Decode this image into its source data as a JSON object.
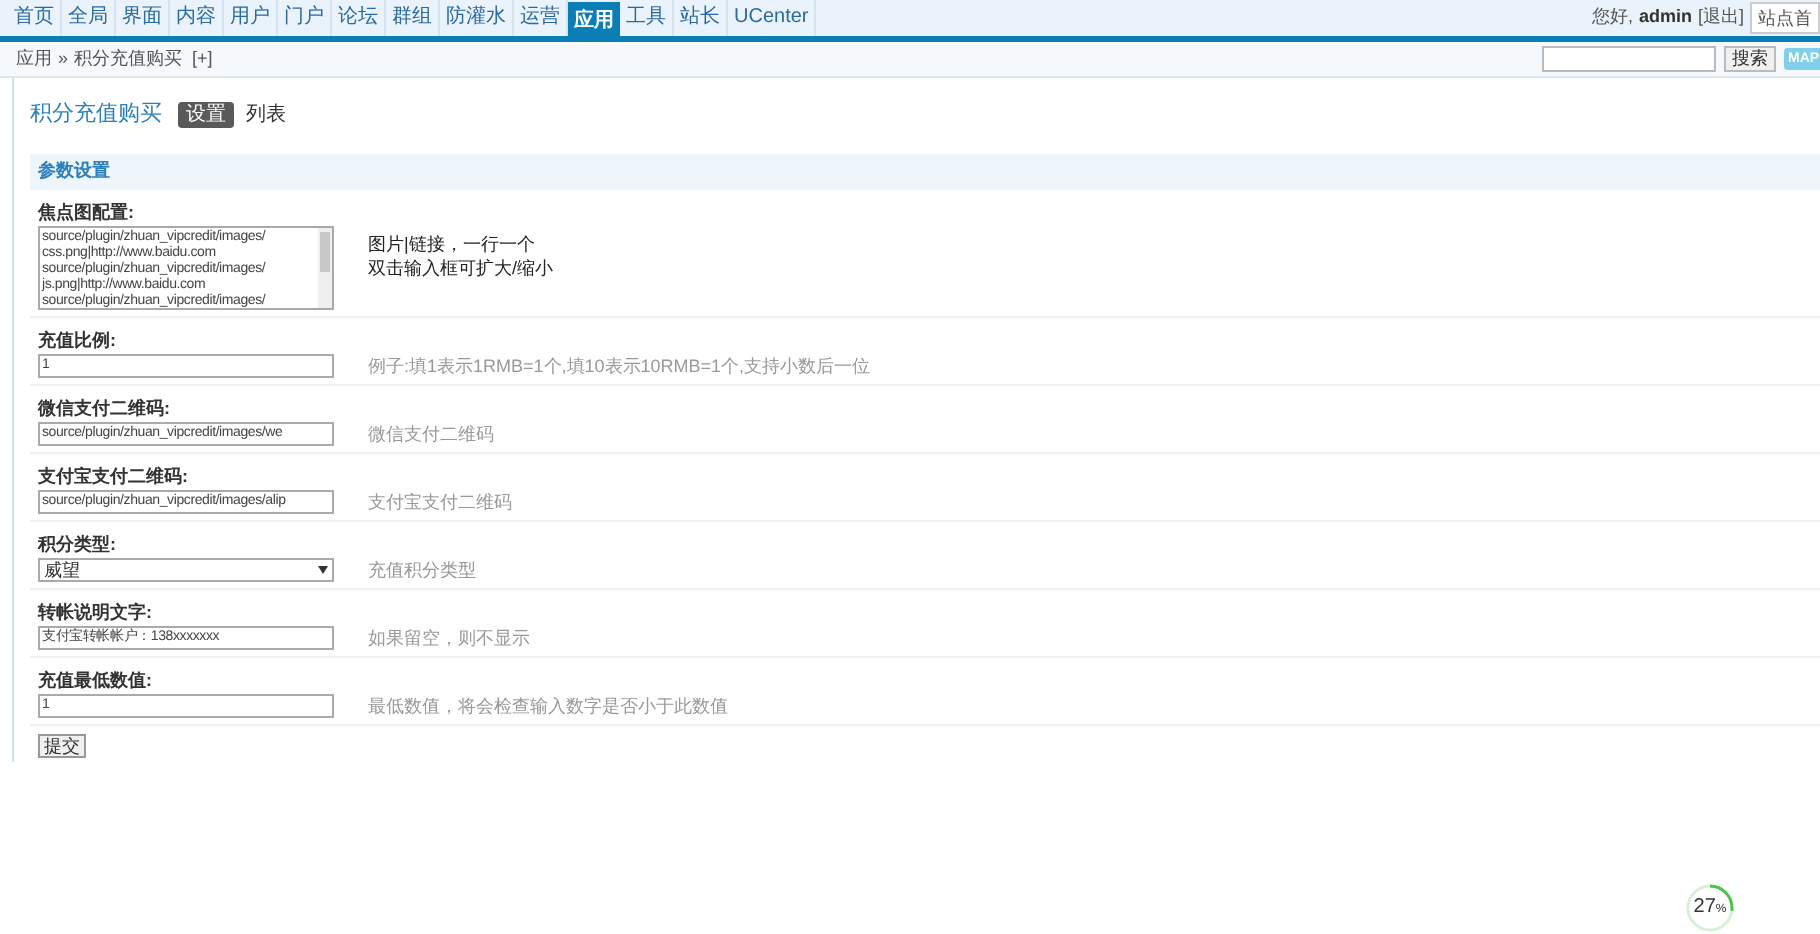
{
  "top_nav": {
    "tabs": [
      {
        "label": "首页",
        "selected": false
      },
      {
        "label": "全局",
        "selected": false
      },
      {
        "label": "界面",
        "selected": false
      },
      {
        "label": "内容",
        "selected": false
      },
      {
        "label": "用户",
        "selected": false
      },
      {
        "label": "门户",
        "selected": false
      },
      {
        "label": "论坛",
        "selected": false
      },
      {
        "label": "群组",
        "selected": false
      },
      {
        "label": "防灌水",
        "selected": false
      },
      {
        "label": "运营",
        "selected": false
      },
      {
        "label": "应用",
        "selected": true
      },
      {
        "label": "工具",
        "selected": false
      },
      {
        "label": "站长",
        "selected": false
      },
      {
        "label": "UCenter",
        "selected": false
      }
    ],
    "greeting": "您好,",
    "user": "admin",
    "logout": "[退出]",
    "site_home": "站点首"
  },
  "breadcrumb": {
    "items": [
      "应用",
      "积分充值购买"
    ],
    "separator": "»",
    "add": "[+]"
  },
  "search": {
    "button": "搜索",
    "map": "MAP"
  },
  "page": {
    "title": "积分充值购买",
    "subtabs": [
      {
        "label": "设置",
        "selected": true
      },
      {
        "label": "列表",
        "selected": false
      }
    ]
  },
  "section": {
    "title": "参数设置"
  },
  "fields": [
    {
      "kind": "textarea",
      "label": "焦点图配置:",
      "lines": [
        "source/plugin/zhuan_vipcredit/images/",
        "css.png|http://www.baidu.com",
        "source/plugin/zhuan_vipcredit/images/",
        "js.png|http://www.baidu.com",
        "source/plugin/zhuan_vipcredit/images/"
      ],
      "hint": [
        "图片|链接，一行一个",
        "双击输入框可扩大/缩小"
      ]
    },
    {
      "kind": "input",
      "label": "充值比例:",
      "value": "1",
      "hint": [
        "例子:填1表示1RMB=1个,填10表示10RMB=1个,支持小数后一位"
      ]
    },
    {
      "kind": "input",
      "label": "微信支付二维码:",
      "value": "source/plugin/zhuan_vipcredit/images/we",
      "hint": [
        "微信支付二维码"
      ]
    },
    {
      "kind": "input",
      "label": "支付宝支付二维码:",
      "value": "source/plugin/zhuan_vipcredit/images/alip",
      "hint": [
        "支付宝支付二维码"
      ]
    },
    {
      "kind": "select",
      "label": "积分类型:",
      "value": "威望",
      "hint": [
        "充值积分类型"
      ]
    },
    {
      "kind": "input",
      "label": "转帐说明文字:",
      "value": "支付宝转帐帐户：138xxxxxxx",
      "hint": [
        "如果留空，则不显示"
      ]
    },
    {
      "kind": "input",
      "label": "充值最低数值:",
      "value": "1",
      "hint": [
        "最低数值，将会检查输入数字是否小于此数值"
      ]
    }
  ],
  "submit": "提交",
  "usage_gauge": {
    "reading": "27",
    "unit": "%",
    "level": 0.27
  }
}
